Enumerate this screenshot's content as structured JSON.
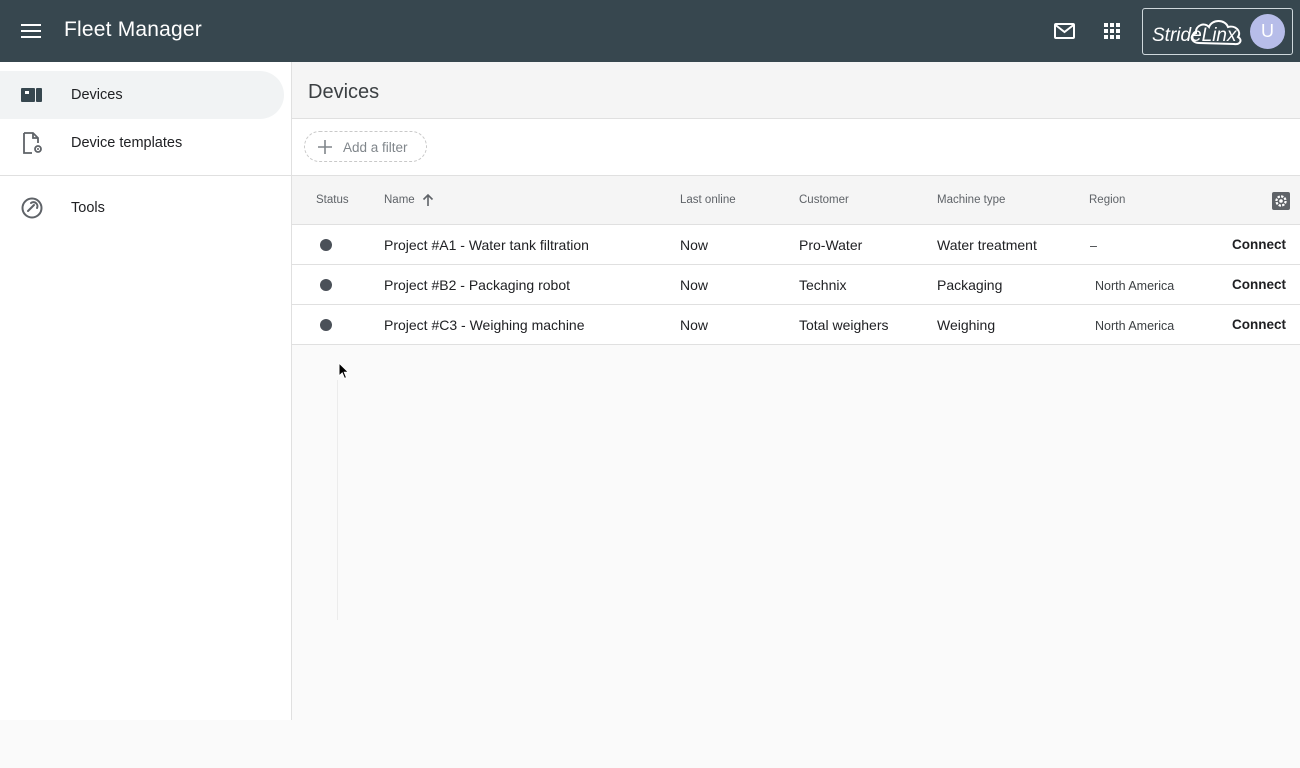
{
  "topbar": {
    "title": "Fleet Manager",
    "menu_icon": "hamburger-menu-icon",
    "mail_icon": "mail-icon",
    "apps_icon": "apps-grid-icon",
    "brand": "StrideLinx",
    "avatar_initial": "U",
    "bg_color": "#37474f"
  },
  "sidebar": {
    "items": [
      {
        "label": "Devices",
        "icon": "devices-icon",
        "active": true
      },
      {
        "label": "Device templates",
        "icon": "device-template-icon",
        "active": false
      },
      {
        "label": "Tools",
        "icon": "tools-icon",
        "active": false
      }
    ]
  },
  "main": {
    "title": "Devices",
    "filter": {
      "label": "Add a filter",
      "icon": "plus-icon"
    },
    "table": {
      "columns": [
        "Status",
        "Name",
        "Last online",
        "Customer",
        "Machine type",
        "Region"
      ],
      "sort": {
        "column": "Name",
        "direction": "ascending"
      },
      "rows": [
        {
          "name": "Project #A1 - Water tank filtration",
          "last_online": "Now",
          "customer": "Pro-Water",
          "machine_type": "Water treatment",
          "region": "–",
          "action": "Connect"
        },
        {
          "name": "Project #B2 - Packaging robot",
          "last_online": "Now",
          "customer": "Technix",
          "machine_type": "Packaging",
          "region": "North America",
          "action": "Connect"
        },
        {
          "name": "Project #C3 - Weighing machine",
          "last_online": "Now",
          "customer": "Total weighers",
          "machine_type": "Weighing",
          "region": "North America",
          "action": "Connect"
        }
      ]
    }
  }
}
